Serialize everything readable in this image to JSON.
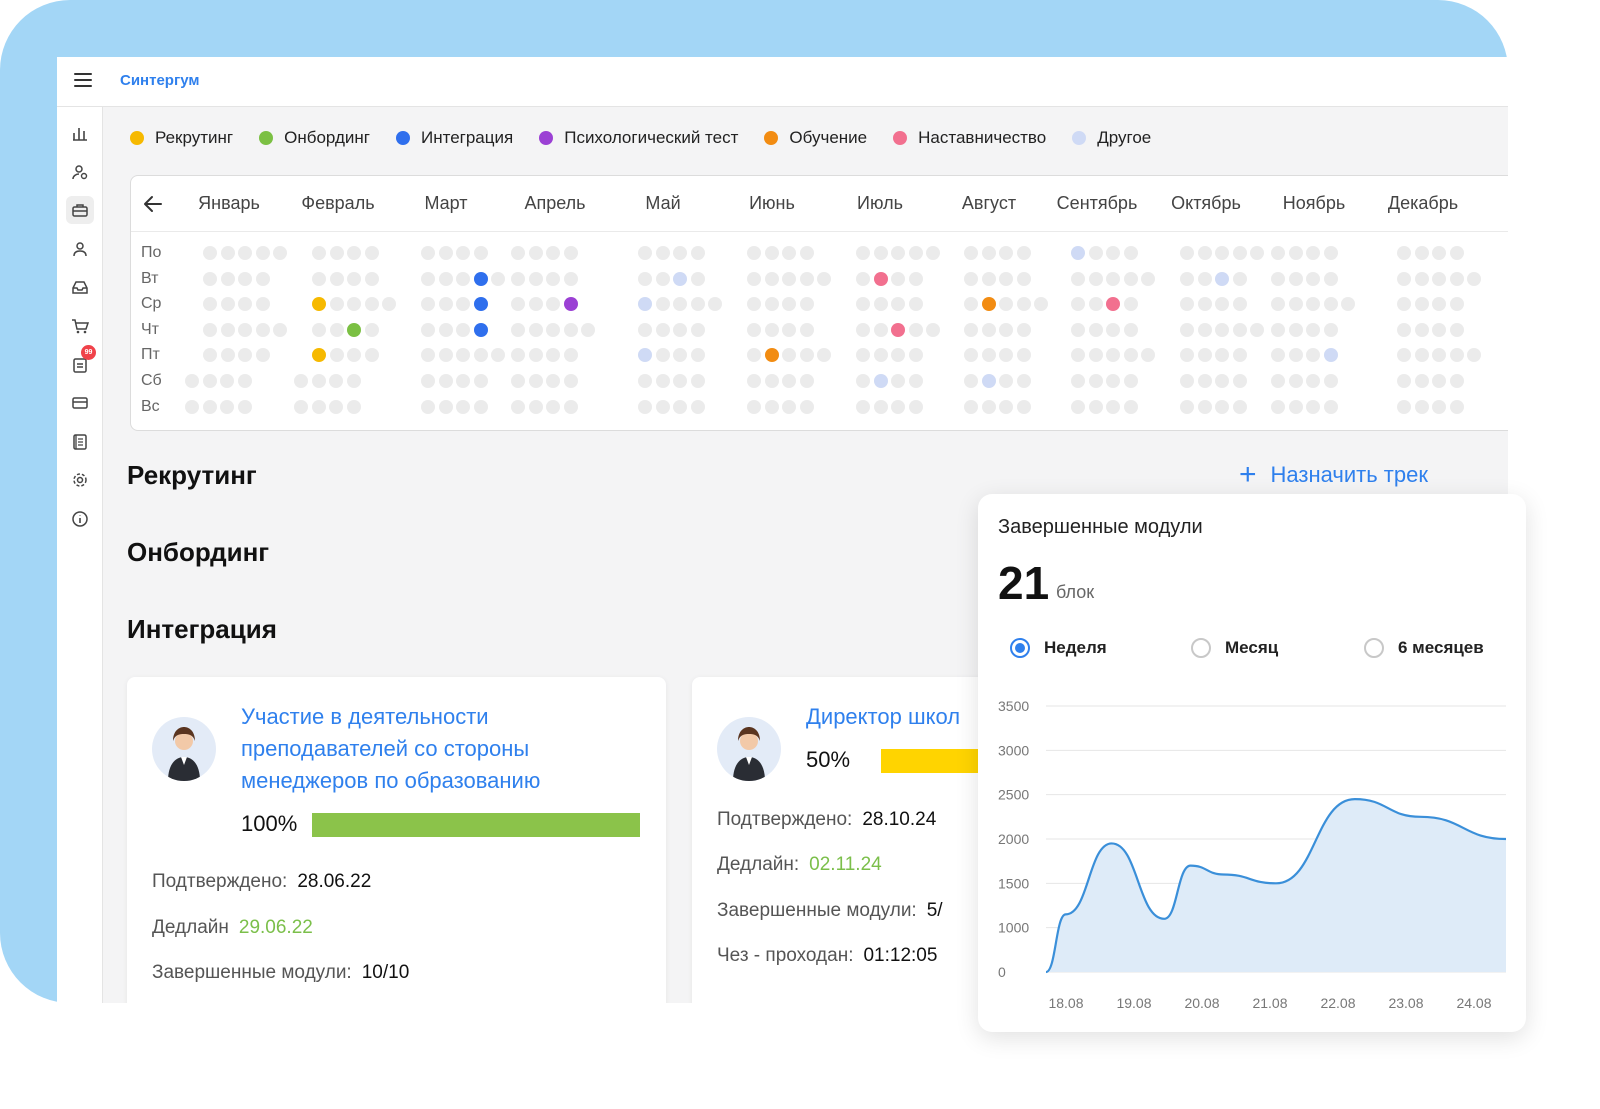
{
  "app": {
    "brand": "Синтергум"
  },
  "sidebar": {
    "icons": [
      "chart-icon",
      "user-search-icon",
      "briefcase-icon",
      "user-icon",
      "inbox-icon",
      "cart-icon",
      "clipboard-icon",
      "card-icon",
      "book-icon",
      "gear-icon",
      "info-icon"
    ],
    "badge": "99"
  },
  "legend": [
    {
      "label": "Рекрутинг",
      "color": "#f6b900"
    },
    {
      "label": "Онбординг",
      "color": "#7bc043"
    },
    {
      "label": "Интеграция",
      "color": "#2f6fed"
    },
    {
      "label": "Психологический тест",
      "color": "#9b40d4"
    },
    {
      "label": "Обучение",
      "color": "#f28c12"
    },
    {
      "label": "Наставничество",
      "color": "#f2708f"
    },
    {
      "label": "Другое",
      "color": "#cfdaf5"
    }
  ],
  "calendar": {
    "months": [
      "Январь",
      "Февраль",
      "Март",
      "Апрель",
      "Май",
      "Июнь",
      "Июль",
      "Август",
      "Сентябрь",
      "Октябрь",
      "Ноябрь",
      "Декабрь"
    ],
    "days": [
      "По",
      "Вт",
      "Ср",
      "Чт",
      "Пт",
      "Сб",
      "Вс"
    ]
  },
  "sections": {
    "recruiting": "Рекрутинг",
    "onboarding": "Онбординг",
    "integration": "Интеграция",
    "assign": "Назначить трек"
  },
  "cards": [
    {
      "title": "Участие в деятельности преподавателей со стороны менеджеров по образованию",
      "title_lines": [
        "Участие в деятельности",
        "преподавателей со стороны",
        "менеджеров по образованию"
      ],
      "progress_label": "100%",
      "progress": 100,
      "progress_color": "#8bc34a",
      "confirmed_label": "Подтверждено:",
      "confirmed": "28.06.22",
      "deadline_label": "Дедлайн",
      "deadline": "29.06.22",
      "modules_label": "Завершенные модули:",
      "modules": "10/10"
    },
    {
      "title": "Директор школ",
      "progress_label": "50%",
      "progress": 50,
      "progress_color": "#ffd400",
      "confirmed_label": "Подтверждено:",
      "confirmed": "28.10.24",
      "deadline_label": "Дедлайн:",
      "deadline": "02.11.24",
      "modules_label": "Завершенные модули:",
      "modules": "5/",
      "passes_label": "Чез - проходан:",
      "passes": "01:12:05"
    }
  ],
  "widget": {
    "title": "Завершенные модули",
    "count": "21",
    "unit": "блок",
    "periods": [
      "Неделя",
      "Месяц",
      "6 месяцев"
    ],
    "selected_period": "Неделя"
  },
  "chart_data": {
    "type": "area",
    "title": "Завершенные модули",
    "categories": [
      "18.08",
      "19.08",
      "20.08",
      "21.08",
      "22.08",
      "23.08",
      "24.08"
    ],
    "x": [
      0,
      0.3,
      1.0,
      1.8,
      2.2,
      2.7,
      3.5,
      4.7,
      5.7,
      7.0
    ],
    "values": [
      0,
      1150,
      1950,
      1100,
      1700,
      1600,
      1500,
      2450,
      2250,
      2000
    ],
    "yticks": [
      "3500",
      "3000",
      "2500",
      "2000",
      "1500",
      "1000",
      "0"
    ],
    "ylim": [
      0,
      3500
    ],
    "grid": true,
    "color": "#3a8fd9",
    "fill": "#deebf8"
  }
}
